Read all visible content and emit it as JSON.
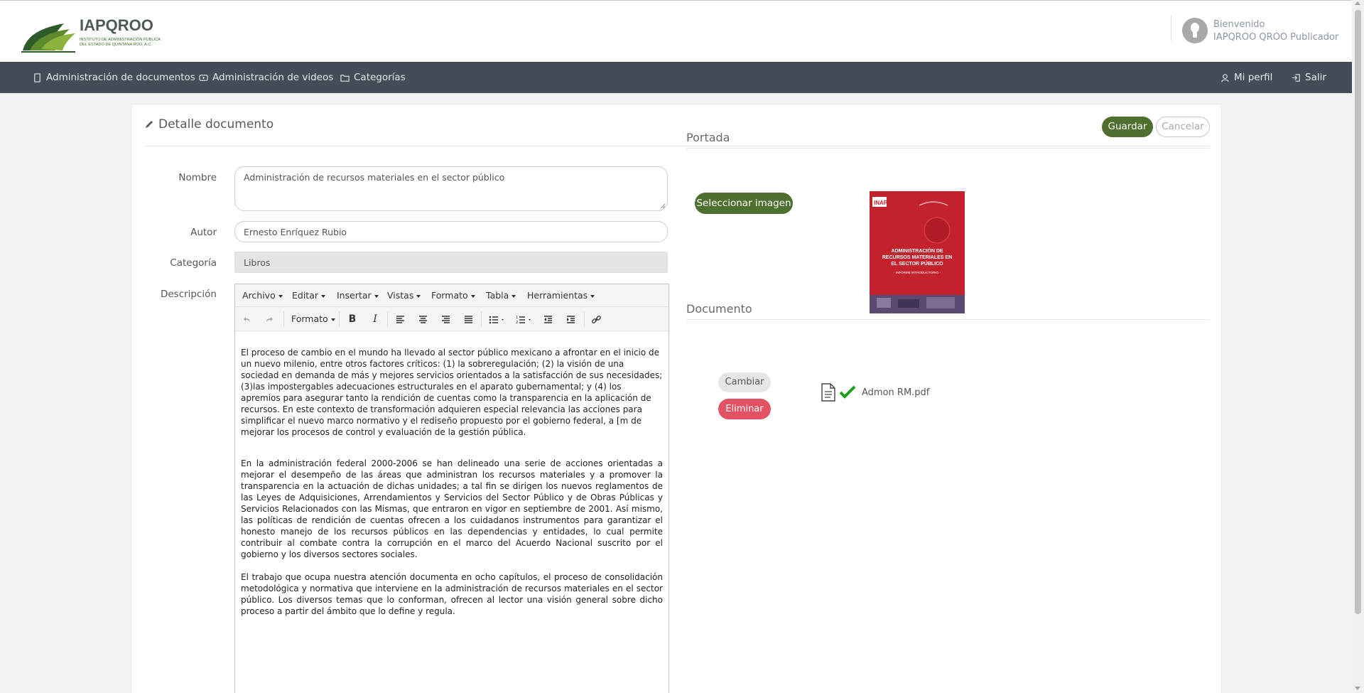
{
  "header": {
    "logo_title": "IAPQROO",
    "logo_subtitle_1": "INSTITUTO DE ADMINISTRACIÓN PÚBLICA",
    "logo_subtitle_2": "DEL ESTADO DE QUINTANA ROO, A.C.",
    "greeting": "Bienvenido",
    "user_name": "IAPQROO QROO Publicador"
  },
  "nav": {
    "left": [
      {
        "label": "Administración de documentos",
        "icon": "document-icon"
      },
      {
        "label": "Administración de videos",
        "icon": "video-icon"
      },
      {
        "label": "Categorías",
        "icon": "folder-icon"
      }
    ],
    "right": [
      {
        "label": "Mi perfil",
        "icon": "user-icon"
      },
      {
        "label": "Salir",
        "icon": "logout-icon"
      }
    ]
  },
  "panel": {
    "title": "Detalle documento",
    "save_label": "Guardar",
    "cancel_label": "Cancelar"
  },
  "form": {
    "nombre_label": "Nombre",
    "nombre_value": "Administración de recursos materiales en el sector público",
    "autor_label": "Autor",
    "autor_value": "Ernesto Enríquez Rubio",
    "categoria_label": "Categoría",
    "categoria_value": "Libros",
    "descripcion_label": "Descripción"
  },
  "editor": {
    "menus": [
      "Archivo",
      "Editar",
      "Insertar",
      "Vistas",
      "Formato",
      "Tabla",
      "Herramientas"
    ],
    "format_label": "Formato",
    "paragraphs": [
      "El proceso de cambio en el mundo ha llevado al sector público mexicano a afrontar en el inicio de un nuevo milenio, entre otros factores críticos: (1) la sobreregulación; (2) la visión de una sociedad en demanda de más y mejores servicios orientados a la satisfacción de sus necesidades; (3)las impostergables adecuaciones estructurales en el aparato gubernamental; y (4) los apremios para asegurar tanto la rendición de cuentas como la transparencia en la aplicación de recursos. En este contexto de transformación adquieren especial relevancia las acciones para simplificar el nuevo marco normativo y el rediseño propuesto por el gobierno federal, a [m de mejorar los procesos de control y evaluación de la gestión pública.",
      "En la administración federal 2000-2006 se han delineado una serie de acciones orientadas a mejorar el desempeño de las áreas que administran los recursos materiales y a promover la transparencia en la actuación de dichas unidades; a tal fin se dirigen los nuevos reglamentos de las Leyes de Adquisiciones, Arrendamientos y Servicios del Sector Público y de Obras Públicas y Servicios Relacionados con las Mismas, que entraron en vigor en septiembre de 2001. Así mismo, las políticas de rendición de cuentas ofrecen a los cuidadanos instrumentos para garantizar el honesto manejo de los recursos públicos en las dependencias y entidades, lo cual permite contribuir al combate contra la corrupción en el marco del Acuerdo Nacional suscrito por el gobierno y los diversos sectores sociales.",
      "El trabajo que ocupa nuestra atención documenta en ocho capítulos, el proceso de consolidación metodológica y normativa que interviene en la administración de recursos materiales en el sector público. Los diversos temas que lo conforman, ofrecen al lector una visión general sobre dicho proceso a partir del ámbito que lo define y regula."
    ]
  },
  "portada": {
    "title": "Portada",
    "select_label": "Seleccionar imagen",
    "cover_title_1": "ADMINISTRACIÓN DE",
    "cover_title_2": "RECURSOS MATERIALES EN",
    "cover_title_3": "EL SECTOR PÚBLICO",
    "cover_subtitle": "- INFORME INTRODUCTORIO -"
  },
  "documento": {
    "title": "Documento",
    "change_label": "Cambiar",
    "delete_label": "Eliminar",
    "file_name": "Admon RM.pdf"
  },
  "colors": {
    "nav_bg": "#424d57",
    "primary_green": "#4e6f2e",
    "danger_red": "#e35262",
    "check_green": "#1e9e1e"
  }
}
